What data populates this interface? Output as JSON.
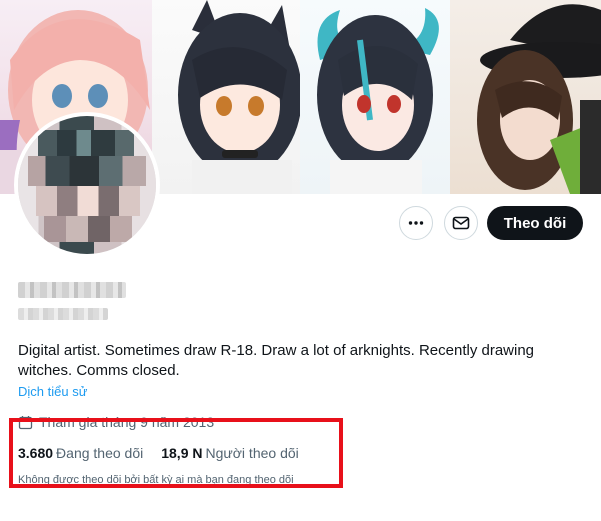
{
  "profile": {
    "bio": "Digital artist. Sometimes draw R-18. Draw a lot of arknights. Recently drawing witches. Comms closed.",
    "translate_label": "Dịch tiểu sử",
    "joined": "Tham gia tháng 9 năm 2013",
    "follow_label": "Theo dõi"
  },
  "stats": {
    "following_count": "3.680",
    "following_label": "Đang theo dõi",
    "followers_count": "18,9 N",
    "followers_label": "Người theo dõi"
  },
  "followed_by_note": "Không được theo dõi bởi bất kỳ ai mà bạn đang theo dõi",
  "icons": {
    "more": "more-icon",
    "message": "envelope-icon",
    "calendar": "calendar-icon"
  },
  "colors": {
    "highlight": "#e8101a",
    "follow_button": "#0f1419",
    "link": "#1d9bf0",
    "secondary_text": "#536471"
  }
}
